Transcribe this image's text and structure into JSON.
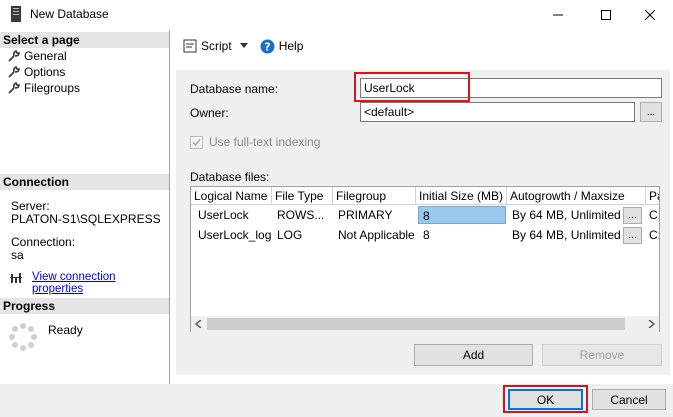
{
  "window": {
    "title": "New Database"
  },
  "left": {
    "select_page_header": "Select a page",
    "pages": [
      {
        "label": "General"
      },
      {
        "label": "Options"
      },
      {
        "label": "Filegroups"
      }
    ],
    "connection_header": "Connection",
    "server_label": "Server:",
    "server_value": "PLATON-S1\\SQLEXPRESS",
    "connection_label": "Connection:",
    "connection_value": "sa",
    "view_connection_properties": "View connection properties",
    "progress_header": "Progress",
    "progress_status": "Ready"
  },
  "toolbar": {
    "script_label": "Script",
    "help_label": "Help"
  },
  "form": {
    "database_name_label": "Database name:",
    "database_name_value": "UserLock",
    "owner_label": "Owner:",
    "owner_value": "<default>",
    "browse_label": "...",
    "fulltext_label": "Use full-text indexing",
    "database_files_label": "Database files:"
  },
  "grid": {
    "columns": [
      "Logical Name",
      "File Type",
      "Filegroup",
      "Initial Size (MB)",
      "Autogrowth / Maxsize",
      "Pa"
    ],
    "rows": [
      {
        "logical_name": "UserLock",
        "file_type": "ROWS...",
        "filegroup": "PRIMARY",
        "initial_size": "8",
        "autogrowth": "By 64 MB, Unlimited",
        "path": "C:\\"
      },
      {
        "logical_name": "UserLock_log",
        "file_type": "LOG",
        "filegroup": "Not Applicable",
        "initial_size": "8",
        "autogrowth": "By 64 MB, Unlimited",
        "path": "C:\\"
      }
    ]
  },
  "buttons": {
    "add": "Add",
    "remove": "Remove",
    "ok": "OK",
    "cancel": "Cancel",
    "ellipsis": "..."
  },
  "colors": {
    "highlight": "#d9141e",
    "selected_cell": "#99c9ef",
    "link": "#0000ee",
    "accent": "#0078d7"
  }
}
